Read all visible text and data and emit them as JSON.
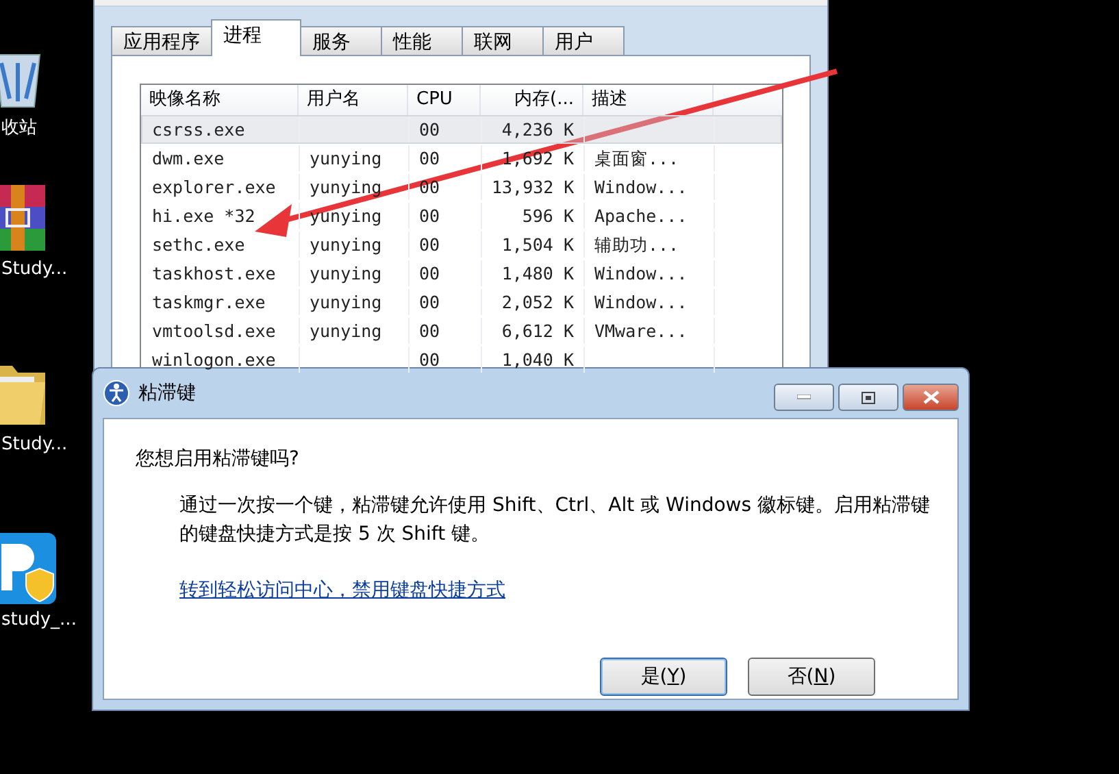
{
  "desktop_icons": [
    {
      "kind": "bin",
      "label": "收站"
    },
    {
      "kind": "archive",
      "label": "Study..."
    },
    {
      "kind": "folder",
      "label": "Study..."
    },
    {
      "kind": "app",
      "label": "study_..."
    }
  ],
  "task_manager": {
    "tabs": [
      {
        "label": "应用程序",
        "selected": false
      },
      {
        "label": "进程",
        "selected": true
      },
      {
        "label": "服务",
        "selected": false
      },
      {
        "label": "性能",
        "selected": false
      },
      {
        "label": "联网",
        "selected": false
      },
      {
        "label": "用户",
        "selected": false
      }
    ],
    "table": {
      "columns": [
        "映像名称",
        "用户名",
        "CPU",
        "内存(...",
        "描述"
      ],
      "rows": [
        {
          "cells": [
            "csrss.exe",
            "",
            "00",
            "4,236 K",
            ""
          ],
          "selected": true
        },
        {
          "cells": [
            "dwm.exe",
            "yunying",
            "00",
            "1,692 K",
            "桌面窗..."
          ],
          "selected": false
        },
        {
          "cells": [
            "explorer.exe",
            "yunying",
            "00",
            "13,932 K",
            "Window..."
          ],
          "selected": false
        },
        {
          "cells": [
            "hi.exe *32",
            "yunying",
            "00",
            "596 K",
            "Apache..."
          ],
          "selected": false
        },
        {
          "cells": [
            "sethc.exe",
            "yunying",
            "00",
            "1,504 K",
            "辅助功..."
          ],
          "selected": false
        },
        {
          "cells": [
            "taskhost.exe",
            "yunying",
            "00",
            "1,480 K",
            "Window..."
          ],
          "selected": false
        },
        {
          "cells": [
            "taskmgr.exe",
            "yunying",
            "00",
            "2,052 K",
            "Window..."
          ],
          "selected": false
        },
        {
          "cells": [
            "vmtoolsd.exe",
            "yunying",
            "00",
            "6,612 K",
            "VMware..."
          ],
          "selected": false
        },
        {
          "cells": [
            "winlogon.exe",
            "",
            "00",
            "1,040 K",
            ""
          ],
          "selected": false
        }
      ]
    }
  },
  "dialog": {
    "title": "粘滞键",
    "question": "您想启用粘滞键吗?",
    "description": "通过一次按一个键，粘滞键允许使用 Shift、Ctrl、Alt 或 Windows 徽标键。启用粘滞键的键盘快捷方式是按 5 次 Shift 键。",
    "link": "转到轻松访问中心，禁用键盘快捷方式",
    "buttons": [
      {
        "before": "是(",
        "mnemonic": "Y",
        "after": ")",
        "default": true
      },
      {
        "before": "否(",
        "mnemonic": "N",
        "after": ")",
        "default": false
      }
    ]
  }
}
